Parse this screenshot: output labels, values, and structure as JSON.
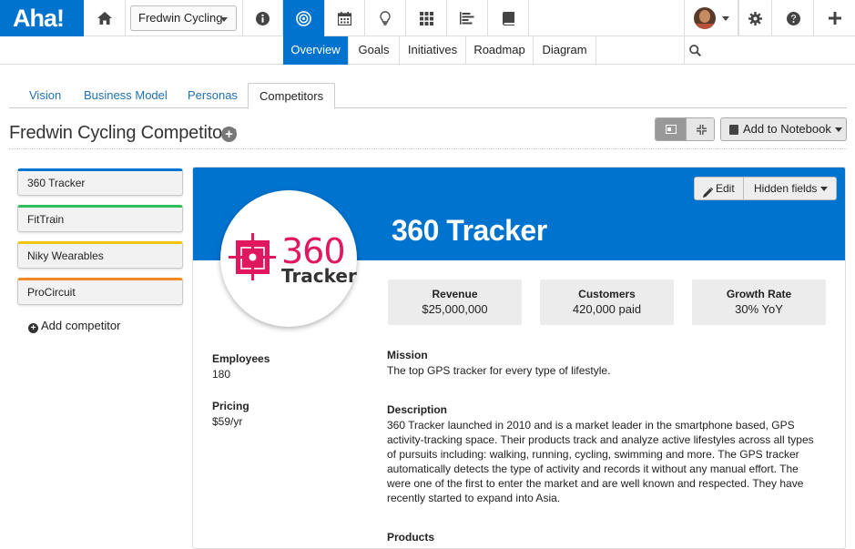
{
  "app": {
    "logo": "Aha!"
  },
  "topbar": {
    "workspace": "Fredwin Cycling",
    "icons": [
      "home-icon",
      "info-icon",
      "target-icon",
      "calendar-icon",
      "lightbulb-icon",
      "grid-icon",
      "roadmap-icon",
      "book-icon"
    ],
    "right_icons": [
      "avatar",
      "gear-icon",
      "help-icon",
      "plus-icon"
    ]
  },
  "subnav": {
    "tabs": [
      {
        "label": "Overview",
        "active": true
      },
      {
        "label": "Goals"
      },
      {
        "label": "Initiatives"
      },
      {
        "label": "Roadmap"
      },
      {
        "label": "Diagram"
      }
    ]
  },
  "page_tabs": [
    {
      "label": "Vision"
    },
    {
      "label": "Business Model"
    },
    {
      "label": "Personas"
    },
    {
      "label": "Competitors",
      "active": true
    }
  ],
  "page": {
    "title": "Fredwin Cycling Competitors",
    "add_notebook": "Add to Notebook"
  },
  "competitors": [
    {
      "name": "360 Tracker",
      "color": "#0073cf"
    },
    {
      "name": "FitTrain",
      "color": "#2ebd59"
    },
    {
      "name": "Niky Wearables",
      "color": "#f1c40f"
    },
    {
      "name": "ProCircuit",
      "color": "#f08a24"
    }
  ],
  "add_competitor": "Add competitor",
  "detail": {
    "name": "360 Tracker",
    "edit": "Edit",
    "hidden_fields": "Hidden fields",
    "logo": {
      "number": "360",
      "word": "Tracker",
      "color": "#e0185f"
    },
    "metrics": [
      {
        "label": "Revenue",
        "value": "$25,000,000"
      },
      {
        "label": "Customers",
        "value": "420,000 paid"
      },
      {
        "label": "Growth Rate",
        "value": "30% YoY"
      }
    ],
    "employees_label": "Employees",
    "employees": "180",
    "pricing_label": "Pricing",
    "pricing": "$59/yr",
    "mission_label": "Mission",
    "mission": "The top GPS tracker for every type of lifestyle.",
    "description_label": "Description",
    "description_lines": [
      "360 Tracker launched in 2010 and is a market leader in the smartphone based, GPS",
      "activity-tracking space. Their products track and analyze active lifestyles across all types",
      "of pursuits including: walking, running, cycling, swimming and more. The GPS tracker",
      "automatically detects the type of activity and records it without any manual effort. The",
      "were one of the first to enter the market and are well known and respected. They have",
      "recently started to expand into Asia."
    ],
    "products_label": "Products"
  }
}
